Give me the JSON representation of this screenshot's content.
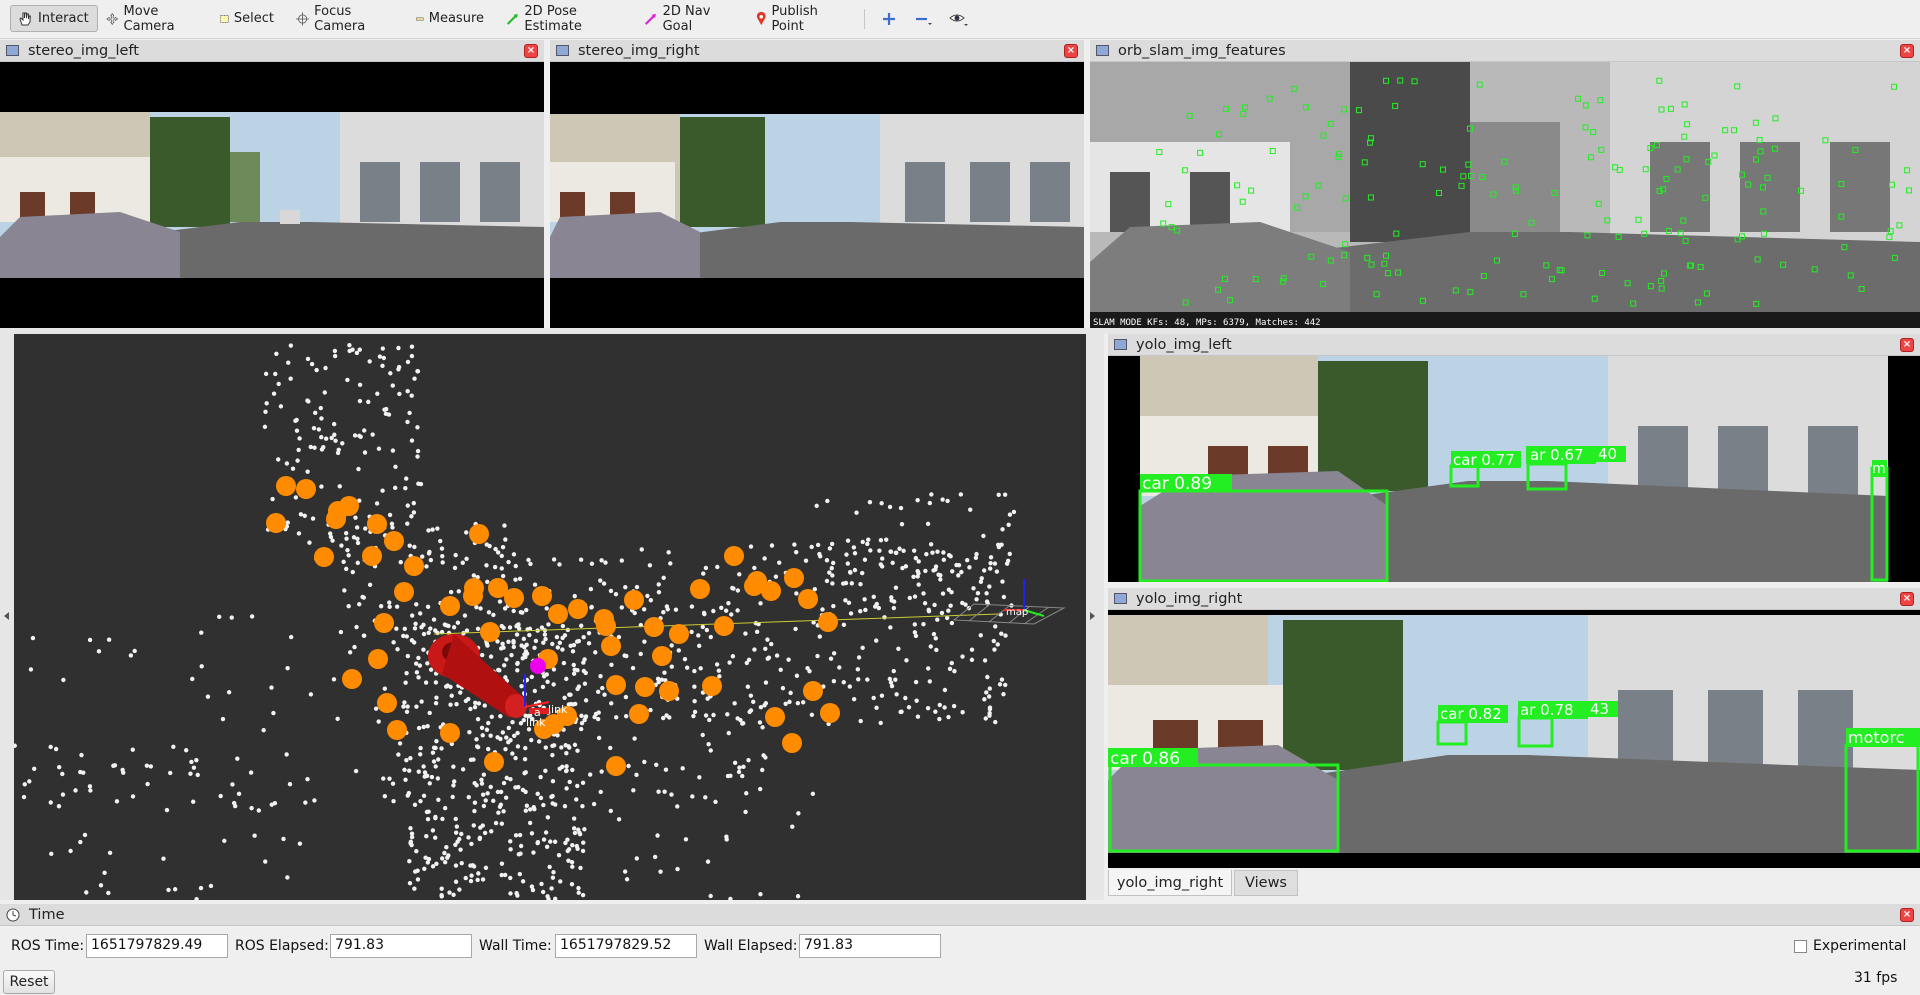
{
  "toolbar": {
    "interact": "Interact",
    "move_camera": "Move Camera",
    "select": "Select",
    "focus_camera": "Focus Camera",
    "measure": "Measure",
    "pose_estimate": "2D Pose Estimate",
    "nav_goal": "2D Nav Goal",
    "publish_point": "Publish Point"
  },
  "panels": {
    "stereo_left": "stereo_img_left",
    "stereo_right": "stereo_img_right",
    "orb_slam": "orb_slam_img_features",
    "yolo_left": "yolo_img_left",
    "yolo_right": "yolo_img_right"
  },
  "orb_status": "SLAM MODE    KFs: 48, MPs: 6379, Matches: 442",
  "detections_left": {
    "car1": "car 0.89",
    "car2": "car 0.77",
    "car3": "ar 0.67",
    "car4": "40",
    "edge": "m"
  },
  "detections_right": {
    "car1": "car 0.86",
    "car2": "car 0.82",
    "car3": "ar 0.78",
    "car4": "43",
    "edge": "motorc"
  },
  "map_labels": {
    "map": "map",
    "link1": "link",
    "link2": "link",
    "a": "a"
  },
  "tabs": {
    "yolo_right": "yolo_img_right",
    "views": "Views"
  },
  "time_panel": {
    "title": "Time",
    "ros_time_label": "ROS Time:",
    "ros_time": "1651797829.49",
    "ros_elapsed_label": "ROS Elapsed:",
    "ros_elapsed": "791.83",
    "wall_time_label": "Wall Time:",
    "wall_time": "1651797829.52",
    "wall_elapsed_label": "Wall Elapsed:",
    "wall_elapsed": "791.83",
    "experimental": "Experimental",
    "reset": "Reset",
    "fps": "31 fps"
  },
  "colors": {
    "detection_green": "#22ee22",
    "sphere_orange": "#ff8c00",
    "viewport_bg": "#303030"
  }
}
